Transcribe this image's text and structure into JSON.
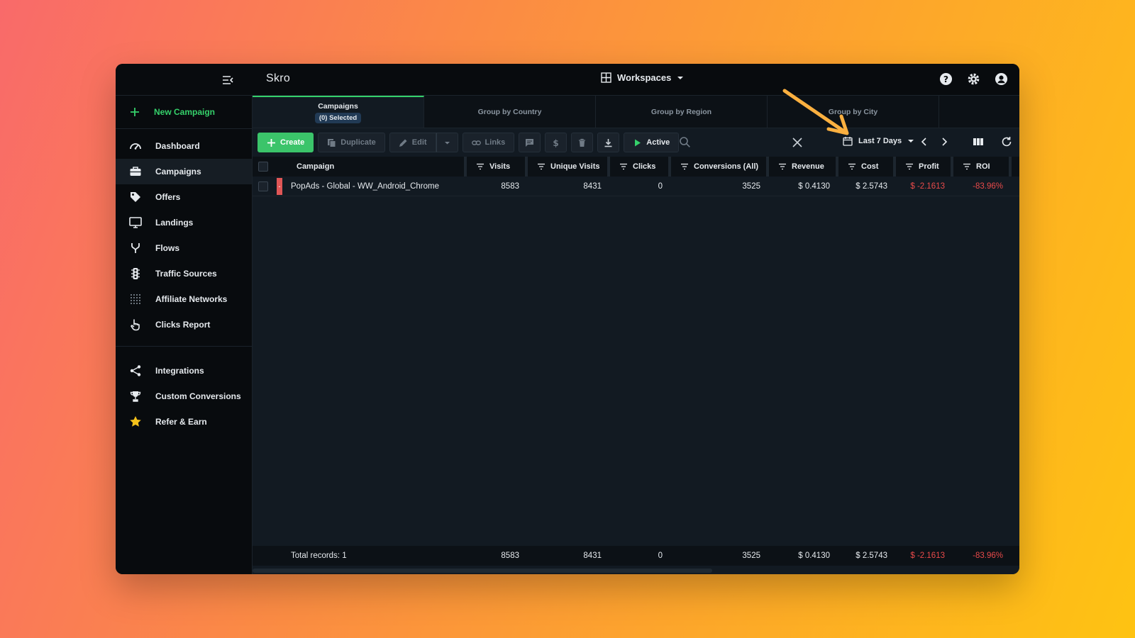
{
  "app": {
    "brand": "Skro",
    "workspaces_label": "Workspaces"
  },
  "sidebar": {
    "new_campaign": "New Campaign",
    "items": [
      {
        "label": "Dashboard",
        "icon": "gauge-icon"
      },
      {
        "label": "Campaigns",
        "icon": "briefcase-icon",
        "active": true
      },
      {
        "label": "Offers",
        "icon": "tag-icon"
      },
      {
        "label": "Landings",
        "icon": "monitor-icon"
      },
      {
        "label": "Flows",
        "icon": "fork-icon"
      },
      {
        "label": "Traffic Sources",
        "icon": "traffic-light-icon"
      },
      {
        "label": "Affiliate Networks",
        "icon": "dots-grid-icon"
      },
      {
        "label": "Clicks Report",
        "icon": "pointer-hand-icon"
      }
    ],
    "bottom_items": [
      {
        "label": "Integrations",
        "icon": "share-icon"
      },
      {
        "label": "Custom Conversions",
        "icon": "trophy-icon"
      },
      {
        "label": "Refer & Earn",
        "icon": "star-icon"
      }
    ]
  },
  "tabs": [
    {
      "label": "Campaigns",
      "badge": "(0) Selected",
      "active": true
    },
    {
      "label": "Group by Country"
    },
    {
      "label": "Group by Region"
    },
    {
      "label": "Group by City"
    }
  ],
  "toolbar": {
    "create": "Create",
    "duplicate": "Duplicate",
    "edit": "Edit",
    "links": "Links",
    "status": "Active",
    "date_range": "Last 7 Days"
  },
  "table": {
    "columns": [
      "Campaign",
      "Visits",
      "Unique Visits",
      "Clicks",
      "Conversions (All)",
      "Revenue",
      "Cost",
      "Profit",
      "ROI"
    ],
    "rows": [
      {
        "campaign": "PopAds - Global - WW_Android_Chrome",
        "status_marker": "-",
        "visits": "8583",
        "unique_visits": "8431",
        "clicks": "0",
        "conversions": "3525",
        "revenue": "$ 0.4130",
        "cost": "$ 2.5743",
        "profit": "$ -2.1613",
        "roi": "-83.96%"
      }
    ],
    "footer": {
      "label": "Total records: 1",
      "visits": "8583",
      "unique_visits": "8431",
      "clicks": "0",
      "conversions": "3525",
      "revenue": "$ 0.4130",
      "cost": "$ 2.5743",
      "profit": "$ -2.1613",
      "roi": "-83.96%"
    }
  },
  "colors": {
    "accent_green": "#35d16b",
    "negative_red": "#e84a4a",
    "annotation_orange": "#fbb040"
  }
}
